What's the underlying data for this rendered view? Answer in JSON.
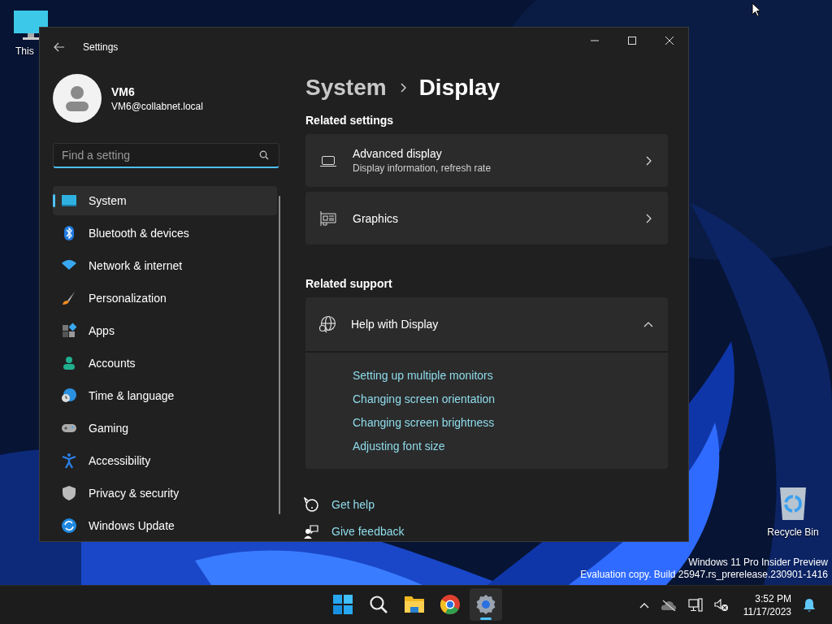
{
  "desktop": {
    "icons": [
      {
        "label": "This"
      },
      {
        "label": "Recycle Bin"
      }
    ],
    "watermark": [
      "Windows 11 Pro Insider Preview",
      "Evaluation copy. Build 25947.rs_prerelease.230901-1416"
    ]
  },
  "window": {
    "title": "Settings",
    "account": {
      "name": "VM6",
      "email": "VM6@collabnet.local"
    },
    "search": {
      "placeholder": "Find a setting"
    },
    "nav": [
      {
        "label": "System",
        "selected": true
      },
      {
        "label": "Bluetooth & devices",
        "selected": false
      },
      {
        "label": "Network & internet",
        "selected": false
      },
      {
        "label": "Personalization",
        "selected": false
      },
      {
        "label": "Apps",
        "selected": false
      },
      {
        "label": "Accounts",
        "selected": false
      },
      {
        "label": "Time & language",
        "selected": false
      },
      {
        "label": "Gaming",
        "selected": false
      },
      {
        "label": "Accessibility",
        "selected": false
      },
      {
        "label": "Privacy & security",
        "selected": false
      },
      {
        "label": "Windows Update",
        "selected": false
      }
    ],
    "breadcrumb": {
      "parent": "System",
      "current": "Display"
    },
    "related_settings": {
      "heading": "Related settings",
      "items": [
        {
          "title": "Advanced display",
          "subtitle": "Display information, refresh rate"
        },
        {
          "title": "Graphics"
        }
      ]
    },
    "related_support": {
      "heading": "Related support",
      "title": "Help with Display",
      "expanded": true,
      "links": [
        "Setting up multiple monitors",
        "Changing screen orientation",
        "Changing screen brightness",
        "Adjusting font size"
      ]
    },
    "footer_links": [
      "Get help",
      "Give feedback"
    ]
  },
  "taskbar": {
    "apps": [
      {
        "selected": false
      },
      {
        "selected": false
      },
      {
        "selected": false
      },
      {
        "selected": false
      },
      {
        "selected": true
      }
    ],
    "time": "3:52 PM",
    "date": "11/17/2023"
  }
}
